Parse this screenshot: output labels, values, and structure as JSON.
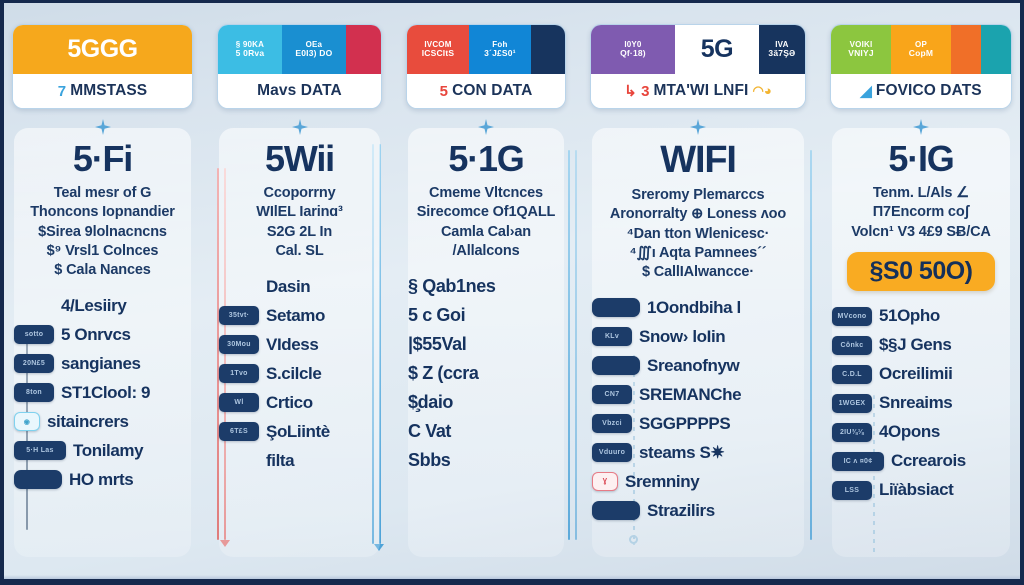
{
  "meta": {
    "background_top": "#cfdce8",
    "background_bottom": "#cfdbe7",
    "frame_color": "#15294d",
    "ink_color": "#16335f"
  },
  "columns": [
    {
      "id": "col-unlimited-5g",
      "header": {
        "label": "MMSTASS",
        "label_mark": "7",
        "label_tail": "",
        "segments": [
          {
            "color": "#f6a81c",
            "line1": "5",
            "line2": "GGG",
            "big": true,
            "text_color": "#ffffff"
          }
        ]
      },
      "title": "5·Fi",
      "description": [
        "Teal mesr of G",
        "Thoncons Iopnandier",
        "$Sirea 9lolnacncns",
        "$⁹ Vrsl1 Colnces",
        "$ Cala Nances"
      ],
      "price": null,
      "features": [
        {
          "badge": "",
          "badge_style": "none",
          "text": "4/Lesiiry"
        },
        {
          "badge": "sotto",
          "badge_style": "dark",
          "text": "5 Onrvcs"
        },
        {
          "badge": "20N£5",
          "badge_style": "dark",
          "text": "sangianes"
        },
        {
          "badge": "8ton",
          "badge_style": "dark",
          "text": "ST1Clool: 9"
        },
        {
          "badge": "◉",
          "badge_style": "cyan",
          "text": "sitaincrers"
        },
        {
          "badge": "5·H Las",
          "badge_style": "dark-wide",
          "text": "Tonilamy"
        },
        {
          "badge": "",
          "badge_style": "dark-pill",
          "text": "HO mrts"
        }
      ]
    },
    {
      "id": "col-mavs-data",
      "header": {
        "label": "Mavs DATA",
        "label_mark": "",
        "label_tail": "",
        "segments": [
          {
            "color": "#3cbde4",
            "line1": "§ 90KA",
            "line2": "5 0Rva",
            "text_color": "#ffffff"
          },
          {
            "color": "#1a8fd1",
            "line1": "OEa",
            "line2": "E0I3) DO",
            "text_color": "#ffffff"
          },
          {
            "color": "#d2304f",
            "line1": "",
            "line2": "",
            "text_color": "#ffffff"
          }
        ]
      },
      "title": "5Wii",
      "description": [
        "Ccoporrny",
        "WIlEL Iarinɑ³",
        "S2G 2L In",
        "Cal. SL"
      ],
      "price": null,
      "features": [
        {
          "badge": "",
          "badge_style": "none",
          "text": "Dasin"
        },
        {
          "badge": "35tvt·",
          "badge_style": "dark",
          "text": "Setamo"
        },
        {
          "badge": "30Mou",
          "badge_style": "dark",
          "text": "VIdess"
        },
        {
          "badge": "1Tvo",
          "badge_style": "dark",
          "text": "S.cilcle"
        },
        {
          "badge": "Wl",
          "badge_style": "dark",
          "text": "Crtico"
        },
        {
          "badge": "6T£S",
          "badge_style": "dark",
          "text": "ŞoLiintè"
        },
        {
          "badge": "",
          "badge_style": "none",
          "text": "filta"
        }
      ]
    },
    {
      "id": "col-con-data",
      "header": {
        "label": "CON DATA",
        "label_mark": "5",
        "label_tail": "",
        "segments": [
          {
            "color": "#e84c3d",
            "line1": "IVCOM",
            "line2": "ICSCItS",
            "text_color": "#ffffff"
          },
          {
            "color": "#1186d6",
            "line1": "Foh",
            "line2": "3´J£S0¹",
            "text_color": "#ffffff"
          },
          {
            "color": "#17345e",
            "line1": "",
            "line2": "",
            "text_color": "#ffffff"
          }
        ]
      },
      "title": "5·1G",
      "description": [
        "Cmeme Vltcnces",
        "Sirecomce Of1QALL",
        "Camla Cal›an",
        "/Allalcons"
      ],
      "price": null,
      "features": [
        {
          "badge": "",
          "badge_style": "none",
          "text": "§ Qab1nes"
        },
        {
          "badge": "",
          "badge_style": "none",
          "text": "5 c Goi"
        },
        {
          "badge": "",
          "badge_style": "none",
          "text": "|$55Val"
        },
        {
          "badge": "",
          "badge_style": "none",
          "text": "$ Z (ccra"
        },
        {
          "badge": "",
          "badge_style": "none",
          "text": "$̧daio"
        },
        {
          "badge": "",
          "badge_style": "none",
          "text": "C Vat"
        },
        {
          "badge": "",
          "badge_style": "none",
          "text": "Sbbs"
        }
      ]
    },
    {
      "id": "col-mta-wi-lnfi",
      "header": {
        "label": "MTA'WI LNFI",
        "label_mark": "↳ 3",
        "label_tail": "◠◕",
        "segments": [
          {
            "color": "#7f5bb0",
            "line1": "I0Y0",
            "line2": "Qf·18)",
            "text_color": "#ffffff"
          },
          {
            "color": "#ffffff",
            "line1": "",
            "line2": "5G",
            "big": true,
            "text_color": "#16335f"
          },
          {
            "color": "#17345e",
            "line1": "IVA",
            "line2": "3ă7ŞƏ",
            "text_color": "#ffffff"
          }
        ]
      },
      "title": "WIFI",
      "description": [
        "Sreromy Plemarccs",
        "Aronorralty ⊕ Loness ʌoo",
        "⁴Dan tton Wlenicesc·",
        "⁴∭ı Aqta Pamnees´´",
        "$ CallIAlwancce·"
      ],
      "price": null,
      "features": [
        {
          "badge": "",
          "badge_style": "dark-pill",
          "text": "1Oondbiha l"
        },
        {
          "badge": "KLv",
          "badge_style": "dark",
          "text": "Snow› loIin"
        },
        {
          "badge": "",
          "badge_style": "dark-pill",
          "text": "Sreanofnyw"
        },
        {
          "badge": "CN7",
          "badge_style": "dark",
          "text": "SREMANChe"
        },
        {
          "badge": "Vbzci",
          "badge_style": "dark",
          "text": "SGGPPPPS"
        },
        {
          "badge": "Vduuro",
          "badge_style": "dark",
          "text": "steams S✷"
        },
        {
          "badge": "Ɣ",
          "badge_style": "redbox",
          "text": "Sremniny"
        },
        {
          "badge": "",
          "badge_style": "dark-pill",
          "text": "Strazilirs"
        }
      ]
    },
    {
      "id": "col-fovico-dats",
      "header": {
        "label": "FOVICO DATS",
        "label_mark": "◢",
        "label_tail": "",
        "segments": [
          {
            "color": "#8cc63f",
            "line1": "VOIKI",
            "line2": "VNIYJ",
            "text_color": "#ffffff"
          },
          {
            "color": "#f9a51a",
            "line1": "OP",
            "line2": "CopM",
            "text_color": "#ffffff"
          },
          {
            "color": "#f06f28",
            "line1": "",
            "line2": "",
            "text_color": "#ffffff"
          },
          {
            "color": "#1ba3ae",
            "line1": "",
            "line2": "",
            "text_color": "#ffffff"
          }
        ]
      },
      "title": "5·IG",
      "description": [
        "Tenm. L/Als ∠",
        "Π7Encorm coʃ",
        "Volcn¹ V3 4£9 SɃ/CA"
      ],
      "price": "§S0 50O)",
      "features": [
        {
          "badge": "MVcono",
          "badge_style": "dark",
          "text": "51Opho"
        },
        {
          "badge": "Cônkc",
          "badge_style": "dark",
          "text": "$§J Gens"
        },
        {
          "badge": "C.D.L",
          "badge_style": "dark",
          "text": "Ocreilimii"
        },
        {
          "badge": "1WGEX",
          "badge_style": "dark",
          "text": "Snreaims"
        },
        {
          "badge": "2IU⅜⅛",
          "badge_style": "dark",
          "text": "4Opons"
        },
        {
          "badge": "IC ʌ ¤0¢",
          "badge_style": "dark-wide",
          "text": "Ccrearois"
        },
        {
          "badge": "LSS",
          "badge_style": "dark",
          "text": "Liïàbsiact"
        }
      ]
    }
  ]
}
